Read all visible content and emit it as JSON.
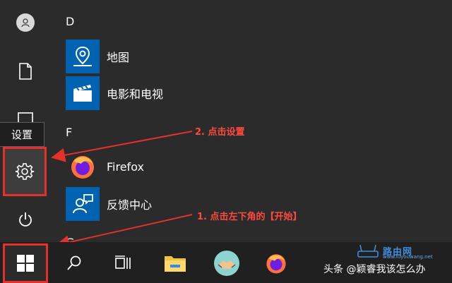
{
  "start_menu": {
    "tooltip": "设置",
    "rail": [
      {
        "name": "user-avatar"
      },
      {
        "name": "documents"
      },
      {
        "name": "pictures"
      },
      {
        "name": "settings"
      },
      {
        "name": "power"
      }
    ],
    "sections": [
      {
        "letter": "D",
        "apps": [
          {
            "label": "地图",
            "tile_color": "#0063b1",
            "icon": "maps-icon"
          },
          {
            "label": "电影和电视",
            "tile_color": "#0063b1",
            "icon": "movies-tv-icon"
          }
        ]
      },
      {
        "letter": "F",
        "apps": [
          {
            "label": "Firefox",
            "tile_color": "#2b2b2b",
            "icon": "firefox-icon"
          },
          {
            "label": "反馈中心",
            "tile_color": "#0063b1",
            "icon": "feedback-hub-icon"
          }
        ]
      }
    ],
    "next_letter_partial": "G"
  },
  "annotations": {
    "step2": "2. 点击设置",
    "step1": "1. 点击左下角的【开始】",
    "color": "#e4312b"
  },
  "taskbar": {
    "items": [
      "start-button",
      "search-icon",
      "task-view-icon",
      "file-explorer-icon",
      "teams-icon",
      "firefox-icon"
    ]
  },
  "watermark": {
    "text": "头条 @颖睿我该怎么办",
    "brand": "路由网",
    "url": "www.luyouwang.net"
  }
}
